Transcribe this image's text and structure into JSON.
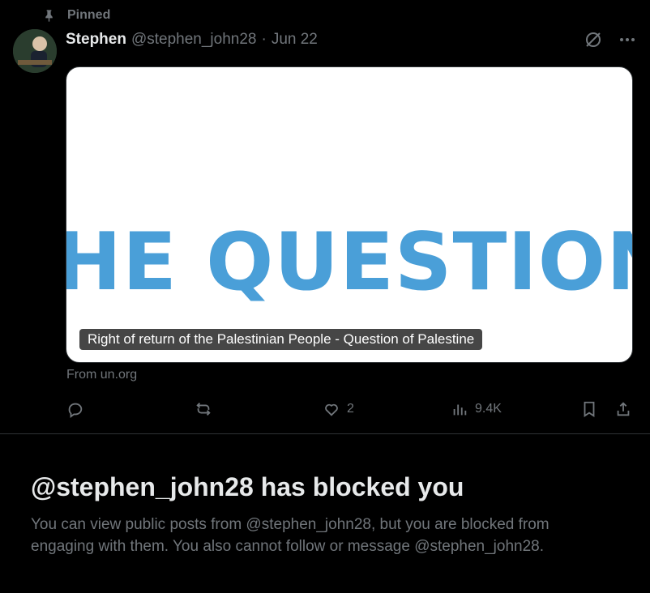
{
  "pinned": {
    "label": "Pinned",
    "icon": "pin-icon"
  },
  "post": {
    "author_name": "Stephen",
    "handle": "@stephen_john28",
    "separator": "·",
    "date": "Jun 22",
    "card": {
      "headline": "HE QUESTION",
      "caption": "Right of return of the Palestinian People - Question of Palestine",
      "source": "From un.org"
    },
    "stats": {
      "likes": "2",
      "views": "9.4K"
    }
  },
  "blocked": {
    "title": "@stephen_john28 has blocked you",
    "description": "You can view public posts from @stephen_john28, but you are blocked from engaging with them. You also cannot follow or message @stephen_john28."
  },
  "colors": {
    "background": "#000000",
    "muted": "#71767b",
    "text": "#e7e9ea",
    "card_headline": "#4a9fd8"
  }
}
